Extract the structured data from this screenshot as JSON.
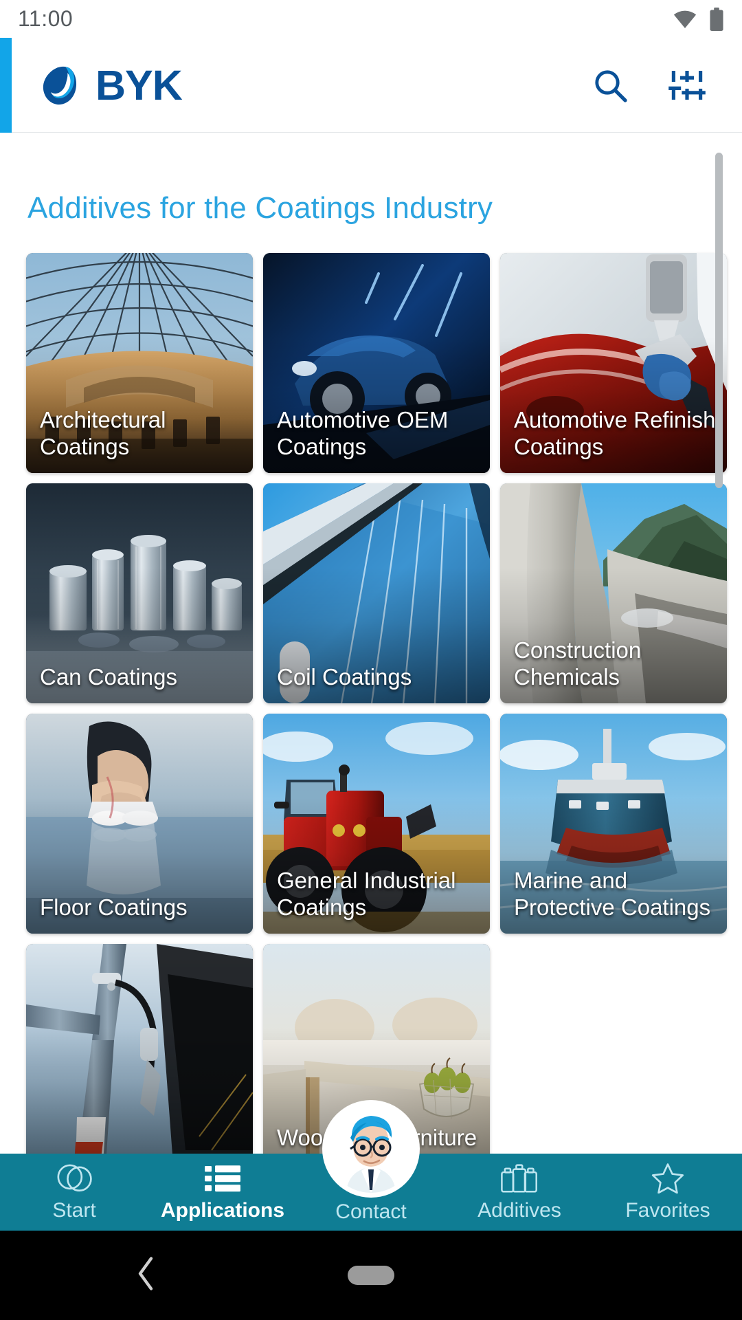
{
  "status_bar": {
    "time": "11:00",
    "icons": [
      "wifi-icon",
      "battery-icon"
    ]
  },
  "header": {
    "brand": "BYK",
    "logo_icon": "byk-logo-icon",
    "accent_color": "#12A5E8",
    "brand_color": "#0A5198",
    "actions": [
      {
        "name": "search-icon",
        "label": "Search"
      },
      {
        "name": "filter-sliders-icon",
        "label": "Filter"
      }
    ]
  },
  "main": {
    "title": "Additives for the Coatings Industry",
    "title_color": "#2BA4E0",
    "cards": [
      {
        "label": "Architectural Coatings",
        "image": "milan-galleria-arcade"
      },
      {
        "label": "Automotive OEM Coatings",
        "image": "blue-sports-car-night"
      },
      {
        "label": "Automotive Refinish Coatings",
        "image": "spray-gun-red-car-body"
      },
      {
        "label": "Can Coatings",
        "image": "metal-cans-stack"
      },
      {
        "label": "Coil Coatings",
        "image": "glass-metal-facade"
      },
      {
        "label": "Construction Chemicals",
        "image": "concrete-dam-mountains"
      },
      {
        "label": "Floor Coatings",
        "image": "gymnast-on-glossy-floor"
      },
      {
        "label": "General Industrial Coatings",
        "image": "red-tractor-field"
      },
      {
        "label": "Marine and Protective Coatings",
        "image": "ship-bow-on-water"
      },
      {
        "label": "",
        "image": "bicycle-frame-fork"
      },
      {
        "label": "Wood and Furniture",
        "image": "wood-table-fruit-bowl"
      }
    ]
  },
  "bottom_nav": {
    "background": "#0F7D94",
    "active_index": 1,
    "items": [
      {
        "label": "Start",
        "icon": "byk-circles-outline-icon"
      },
      {
        "label": "Applications",
        "icon": "list-icon"
      },
      {
        "label": "Contact",
        "icon": "scientist-avatar-icon"
      },
      {
        "label": "Additives",
        "icon": "bottles-icon"
      },
      {
        "label": "Favorites",
        "icon": "star-icon"
      }
    ]
  },
  "system_nav": {
    "back": "back-chevron-icon",
    "home": "home-pill-icon"
  }
}
